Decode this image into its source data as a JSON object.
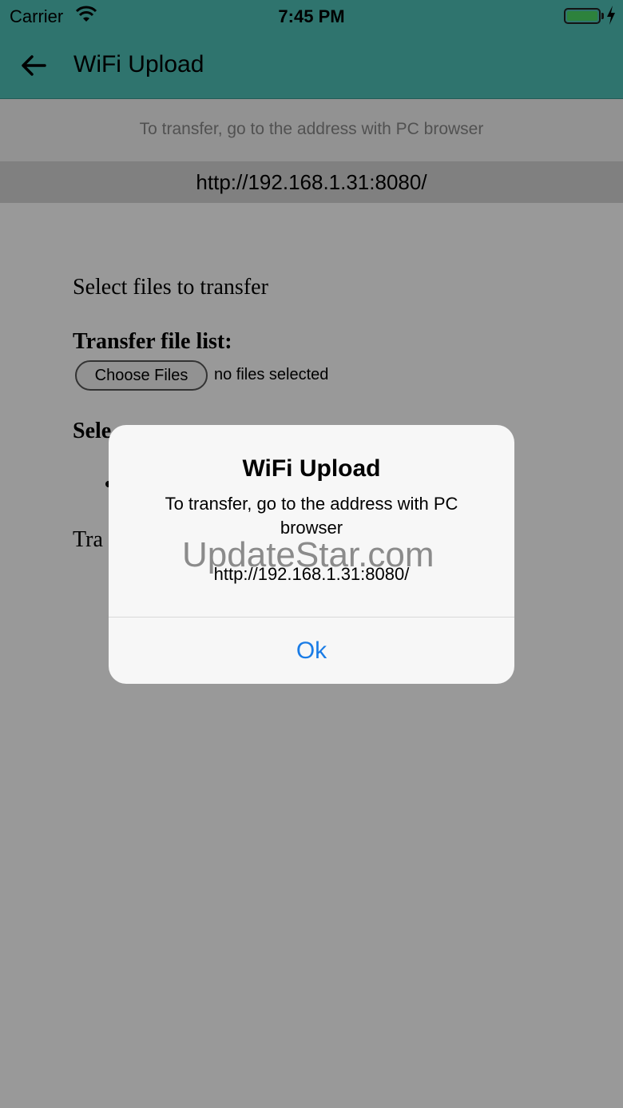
{
  "status_bar": {
    "carrier": "Carrier",
    "time": "7:45 PM",
    "battery_level": 1.0,
    "accent": "#4cd964"
  },
  "nav": {
    "back_icon": "arrow-left-icon",
    "title": "WiFi Upload",
    "color": "#4fc1b8"
  },
  "hint": "To transfer, go to the address with PC browser",
  "url": "http://192.168.1.31:8080/",
  "web": {
    "select_label": "Select files to transfer",
    "list_heading": "Transfer file list:",
    "choose_button": "Choose Files",
    "no_files": "no files selected",
    "selected_heading_partial": "Sele",
    "transfer_partial": "Tra"
  },
  "alert": {
    "title": "WiFi Upload",
    "message": "To transfer, go to the address with PC browser",
    "url": "http://192.168.1.31:8080/",
    "ok_label": "Ok",
    "ok_color": "#1a7ce6"
  },
  "watermark": "UpdateStar.com"
}
